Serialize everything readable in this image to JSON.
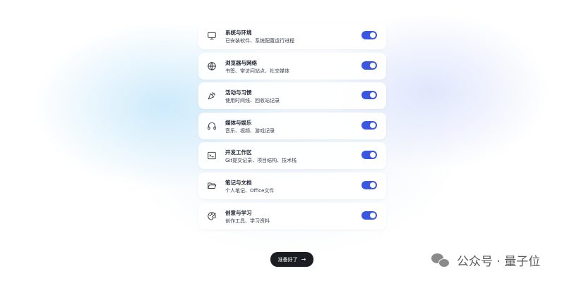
{
  "items": [
    {
      "icon": "monitor-icon",
      "title": "系统与环境",
      "desc": "已安装软件、系统配置运行进程",
      "enabled": true
    },
    {
      "icon": "globe-icon",
      "title": "浏览器与网络",
      "desc": "书签、常访问站点、社交媒体",
      "enabled": true
    },
    {
      "icon": "party-popper-icon",
      "title": "活动与习惯",
      "desc": "使用时间线、回收站记录",
      "enabled": true
    },
    {
      "icon": "headphones-icon",
      "title": "媒体与娱乐",
      "desc": "音乐、视频、游戏记录",
      "enabled": true
    },
    {
      "icon": "terminal-icon",
      "title": "开发工作区",
      "desc": "Git提交记录、项目结构、技术栈",
      "enabled": true
    },
    {
      "icon": "folder-open-icon",
      "title": "笔记与文档",
      "desc": "个人笔记、Office文件",
      "enabled": true
    },
    {
      "icon": "palette-icon",
      "title": "创意与学习",
      "desc": "创作工具、学习资料",
      "enabled": true
    }
  ],
  "ready_button": {
    "label": "准备好了",
    "icon": "arrow-right-icon"
  },
  "watermark": {
    "icon": "wechat-icon",
    "text": "公众号 · 量子位"
  },
  "colors": {
    "toggle_on": "#3b56e0",
    "button_bg": "#1c1d22"
  }
}
